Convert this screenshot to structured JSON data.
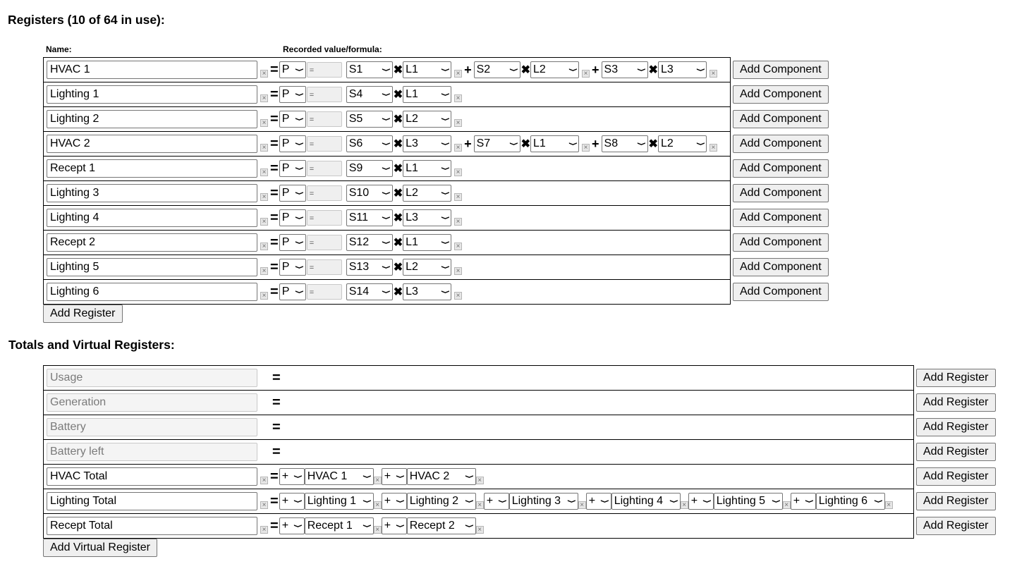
{
  "registers": {
    "heading": "Registers (10 of 64 in use):",
    "col_name": "Name:",
    "col_value": "Recorded value/formula:",
    "add_component_label": "Add Component",
    "add_register_label": "Add Register",
    "rows": [
      {
        "name": "HVAC 1",
        "type": "P",
        "eq": "=",
        "components": [
          {
            "s": "S1",
            "l": "L1"
          },
          {
            "s": "S2",
            "l": "L2"
          },
          {
            "s": "S3",
            "l": "L3"
          }
        ]
      },
      {
        "name": "Lighting 1",
        "type": "P",
        "eq": "=",
        "components": [
          {
            "s": "S4",
            "l": "L1"
          }
        ]
      },
      {
        "name": "Lighting 2",
        "type": "P",
        "eq": "=",
        "components": [
          {
            "s": "S5",
            "l": "L2"
          }
        ]
      },
      {
        "name": "HVAC 2",
        "type": "P",
        "eq": "=",
        "components": [
          {
            "s": "S6",
            "l": "L3"
          },
          {
            "s": "S7",
            "l": "L1"
          },
          {
            "s": "S8",
            "l": "L2"
          }
        ]
      },
      {
        "name": "Recept 1",
        "type": "P",
        "eq": "=",
        "components": [
          {
            "s": "S9",
            "l": "L1"
          }
        ]
      },
      {
        "name": "Lighting 3",
        "type": "P",
        "eq": "=",
        "components": [
          {
            "s": "S10",
            "l": "L2"
          }
        ]
      },
      {
        "name": "Lighting 4",
        "type": "P",
        "eq": "=",
        "components": [
          {
            "s": "S11",
            "l": "L3"
          }
        ]
      },
      {
        "name": "Recept 2",
        "type": "P",
        "eq": "=",
        "components": [
          {
            "s": "S12",
            "l": "L1"
          }
        ]
      },
      {
        "name": "Lighting 5",
        "type": "P",
        "eq": "=",
        "components": [
          {
            "s": "S13",
            "l": "L2"
          }
        ]
      },
      {
        "name": "Lighting 6",
        "type": "P",
        "eq": "=",
        "components": [
          {
            "s": "S14",
            "l": "L3"
          }
        ]
      }
    ]
  },
  "totals": {
    "heading": "Totals and Virtual Registers:",
    "add_register_label": "Add Register",
    "add_virtual_label": "Add Virtual Register",
    "rows": [
      {
        "name": "Usage",
        "readonly": true,
        "terms": []
      },
      {
        "name": "Generation",
        "readonly": true,
        "terms": []
      },
      {
        "name": "Battery",
        "readonly": true,
        "terms": []
      },
      {
        "name": "Battery left",
        "readonly": true,
        "terms": []
      },
      {
        "name": "HVAC Total",
        "readonly": false,
        "terms": [
          {
            "op": "+",
            "reg": "HVAC 1"
          },
          {
            "op": "+",
            "reg": "HVAC 2"
          }
        ]
      },
      {
        "name": "Lighting Total",
        "readonly": false,
        "terms": [
          {
            "op": "+",
            "reg": "Lighting 1"
          },
          {
            "op": "+",
            "reg": "Lighting 2"
          },
          {
            "op": "+",
            "reg": "Lighting 3"
          },
          {
            "op": "+",
            "reg": "Lighting 4"
          },
          {
            "op": "+",
            "reg": "Lighting 5"
          },
          {
            "op": "+",
            "reg": "Lighting 6"
          }
        ]
      },
      {
        "name": "Recept Total",
        "readonly": false,
        "terms": [
          {
            "op": "+",
            "reg": "Recept 1"
          },
          {
            "op": "+",
            "reg": "Recept 2"
          }
        ]
      }
    ]
  },
  "glyphs": {
    "equals": "=",
    "plus": "+",
    "times": "✖",
    "remove": "×",
    "chevron": "⌄"
  }
}
